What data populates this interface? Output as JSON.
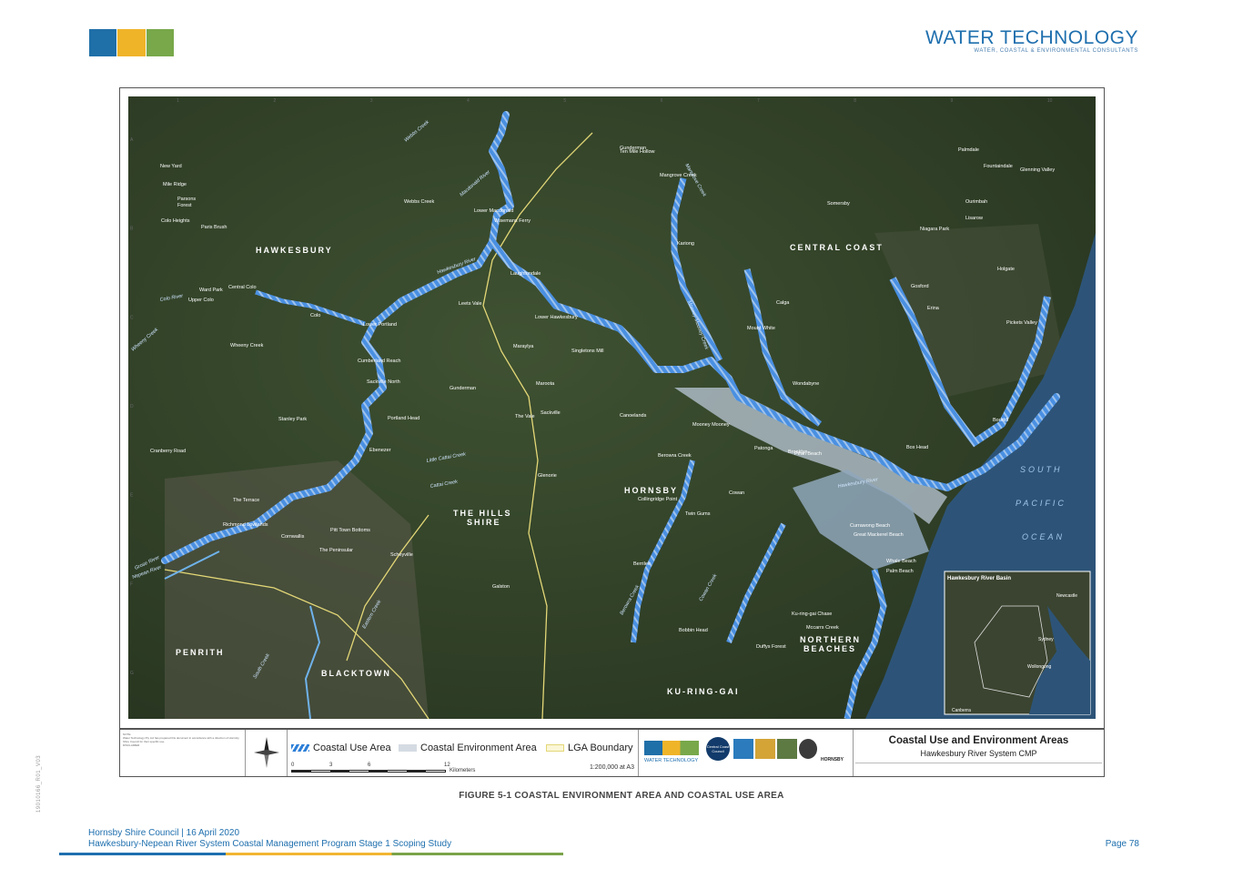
{
  "header": {
    "brand_title": "WATER TECHNOLOGY",
    "brand_subtitle": "WATER, COASTAL & ENVIRONMENTAL CONSULTANTS",
    "tile_colors": [
      "#1f6fa8",
      "#f0b429",
      "#78a84a"
    ]
  },
  "map": {
    "regions": [
      "HAWKESBURY",
      "CENTRAL COAST",
      "HORNSBY",
      "THE HILLS",
      "SHIRE",
      "PENRITH",
      "BLACKTOWN",
      "KU-RING-GAI",
      "NORTHERN",
      "BEACHES"
    ],
    "ocean_labels": [
      "SOUTH",
      "PACIFIC",
      "OCEAN"
    ],
    "towns": [
      "New Yard",
      "Mile Ridge",
      "Parsons",
      "Forest",
      "Colo Heights",
      "Paris Brush",
      "Ward Park",
      "Central Colo",
      "Upper Colo",
      "Colo",
      "Wheeny Creek",
      "Lower Portland",
      "Cumberland Reach",
      "Sackville North",
      "Portland Head",
      "Stanley Park",
      "Ebenezer",
      "Cranberry Road",
      "The Terrace",
      "Richmond Lowlands",
      "Cornwallis",
      "Pitt Town Bottoms",
      "The Peninsular",
      "Scheyville",
      "Maraylya",
      "Wisemans Ferry",
      "Lower Macdonald",
      "Laughtondale",
      "Webbs Creek",
      "Leets Vale",
      "Lower Hawkesbury",
      "Singletons Mill",
      "Gunderman",
      "Maroota",
      "Sackville",
      "Canoelands",
      "The Vale",
      "Glenorie",
      "Berowra Creek",
      "Cowan",
      "Brooklyn",
      "Mooney Mooney",
      "Wondabyne",
      "Patonga",
      "Pearl Beach",
      "Palm Beach",
      "Mount White",
      "Calga",
      "Somersby",
      "Mangrove Creek",
      "Gunderman",
      "Ten Mile Hollow",
      "Kariong",
      "Gosford",
      "Erina",
      "Niagara Park",
      "Lisarow",
      "Ourimbah",
      "Palmdale",
      "Fountaindale",
      "Glenning Valley",
      "Holgate",
      "Pickets Valley",
      "Bouddi",
      "Box Head",
      "Currawong Beach",
      "Great Mackerel Beach",
      "Whale Beach",
      "Ku-ring-gai Chase",
      "Bobbin Head",
      "Mccarrs Creek",
      "Duffys Forest",
      "Berrilee",
      "Twin Gums",
      "Collingridge Point",
      "Galston"
    ],
    "rivers": [
      "Webbs Creek",
      "Macdonald River",
      "Hawkesbury River",
      "Colo River",
      "Wheeny Creek",
      "Little Cattai Creek",
      "Cattai Creek",
      "Nepean River",
      "Grose River",
      "Mangrove Creek",
      "Mooney Mooney Creek",
      "Berowra Creek",
      "Cowan Creek",
      "Hawkesbury River",
      "Eastern Creek",
      "South Creek"
    ],
    "inset_title": "Hawkesbury River Basin",
    "inset_towns": [
      "Newcastle",
      "Sydney",
      "Wollongong",
      "Canberra"
    ],
    "grid_cols": [
      "1",
      "2",
      "3",
      "4",
      "5",
      "6",
      "7",
      "8",
      "9",
      "10"
    ],
    "grid_rows": [
      "A",
      "B",
      "C",
      "D",
      "E",
      "F",
      "G"
    ]
  },
  "legend": {
    "notes_heading": "NOTE:",
    "notes": "Water Technology Pty Ltd has prepared this document in accordance with a direction of Hornsby Shire Council for their specific use.",
    "disclaimer_heading": "DISCLAIMER",
    "keys": [
      "Coastal Use Area",
      "Coastal Environment Area",
      "LGA Boundary"
    ],
    "colors": {
      "coastal_use": "#2d7fd8",
      "coastal_env": "#d5dbe2",
      "lga_boundary": "#e3d777"
    },
    "scale_ticks": [
      "0",
      "3",
      "6",
      "12"
    ],
    "scale_unit": "Kilometers",
    "scale_ratio": "1:200,000 at A3",
    "logo_names": [
      "WATER TECHNOLOGY",
      "Central Coast Council",
      "HORNSBY"
    ],
    "title_main": "Coastal Use and Environment Areas",
    "title_sub": "Hawkesbury River System CMP"
  },
  "caption": "FIGURE 5-1   COASTAL ENVIRONMENT AREA AND COASTAL USE AREA",
  "footer": {
    "side_code": "19010166_R01_V03",
    "line1": "Hornsby Shire Council | 16 April 2020",
    "line2": "Hawkesbury-Nepean River System Coastal Management Program Stage 1 Scoping Study",
    "page": "Page 78"
  }
}
